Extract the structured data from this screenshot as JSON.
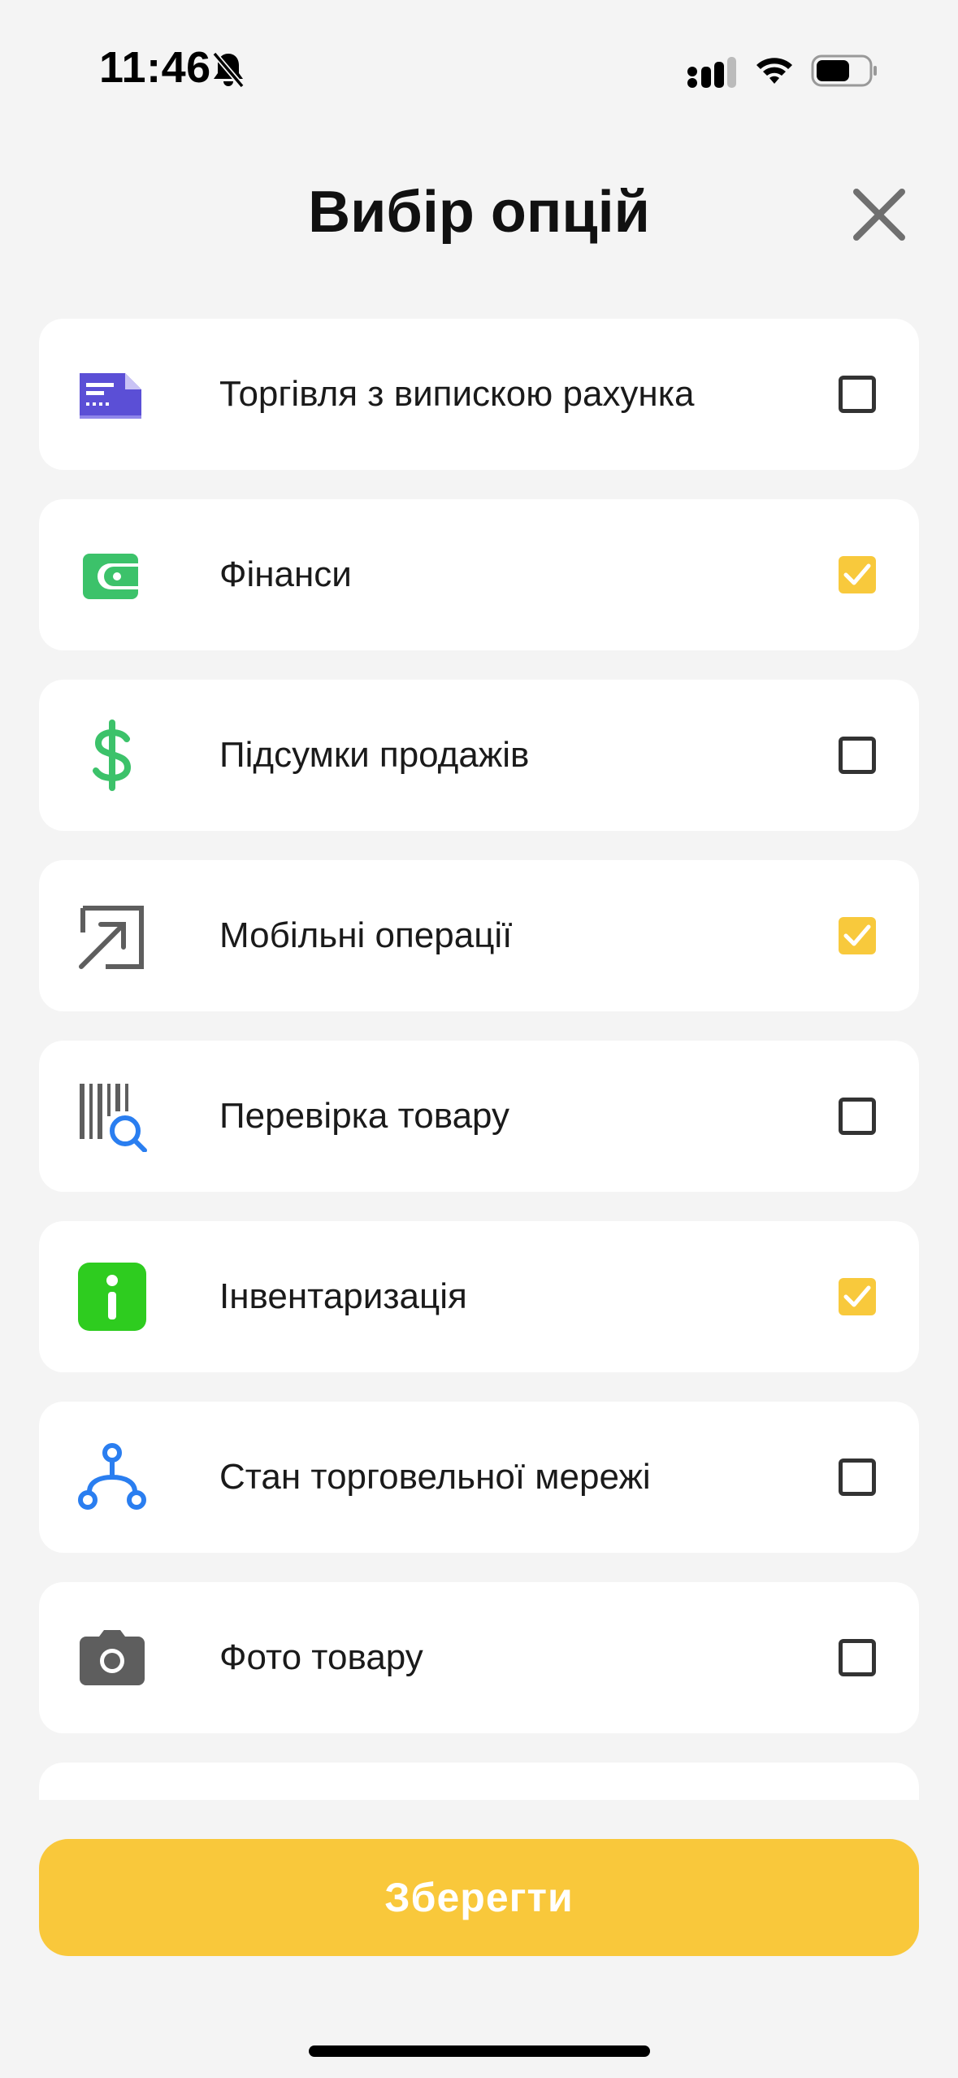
{
  "status_bar": {
    "time": "11:46",
    "icons": [
      "bell-slash-icon",
      "signal-icon",
      "wifi-icon",
      "battery-icon"
    ]
  },
  "header": {
    "title": "Вибір опцій",
    "close_icon": "close-icon"
  },
  "options": [
    {
      "label": "Торгівля з випискою рахунка",
      "icon": "invoice-icon",
      "checked": false
    },
    {
      "label": "Фінанси",
      "icon": "wallet-icon",
      "checked": true
    },
    {
      "label": "Підсумки продажів",
      "icon": "dollar-icon",
      "checked": false
    },
    {
      "label": "Мобільні операції",
      "icon": "external-arrow-icon",
      "checked": true
    },
    {
      "label": "Перевірка товару",
      "icon": "barcode-search-icon",
      "checked": false
    },
    {
      "label": "Інвентаризація",
      "icon": "info-icon",
      "checked": true
    },
    {
      "label": "Стан торговельної мережі",
      "icon": "network-icon",
      "checked": false
    },
    {
      "label": "Фото товару",
      "icon": "camera-icon",
      "checked": false
    }
  ],
  "save_button": {
    "label": "Зберегти"
  },
  "colors": {
    "accent": "#f9c83b",
    "background": "#f4f4f4",
    "card": "#ffffff"
  }
}
